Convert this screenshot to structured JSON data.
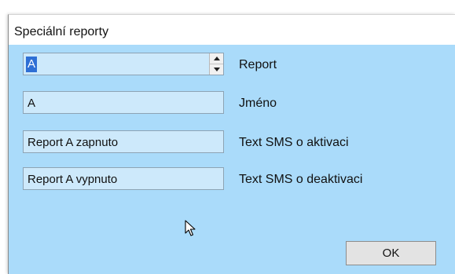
{
  "window": {
    "title": "Speciální reporty"
  },
  "fields": {
    "report": {
      "value": "A",
      "label": "Report"
    },
    "name": {
      "value": "A",
      "label": "Jméno"
    },
    "sms_on": {
      "value": "Report A zapnuto",
      "label": "Text SMS o aktivaci"
    },
    "sms_off": {
      "value": "Report A vypnuto",
      "label": "Text SMS o deaktivaci"
    }
  },
  "buttons": {
    "ok": "OK"
  },
  "icons": {
    "spin_up": "arrow-up-icon",
    "spin_down": "arrow-down-icon",
    "cursor": "mouse-pointer-icon"
  },
  "colors": {
    "dialog_background": "#aadbfa",
    "field_background": "#cde9fb",
    "selection": "#2e6fd5"
  }
}
